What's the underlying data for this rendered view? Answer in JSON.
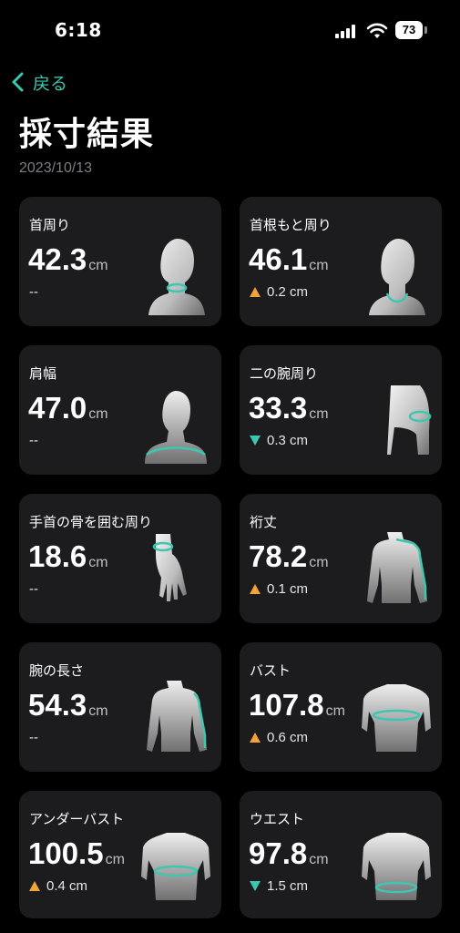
{
  "status": {
    "time": "6:18",
    "battery": "73"
  },
  "nav": {
    "back_label": "戻る"
  },
  "header": {
    "title": "採寸結果",
    "date": "2023/10/13"
  },
  "colors": {
    "accent": "#3cc7b0",
    "increase": "#f0a43a",
    "decrease": "#3cc7b0",
    "card": "#1c1c1e"
  },
  "cards": [
    {
      "label": "首周り",
      "value": "42.3",
      "unit": "cm",
      "change": "--",
      "trend": "none",
      "figure": "neck-figure-icon"
    },
    {
      "label": "首根もと周り",
      "value": "46.1",
      "unit": "cm",
      "change": "0.2 cm",
      "trend": "up",
      "figure": "neck-base-figure-icon"
    },
    {
      "label": "肩幅",
      "value": "47.0",
      "unit": "cm",
      "change": "--",
      "trend": "none",
      "figure": "shoulder-figure-icon"
    },
    {
      "label": "二の腕周り",
      "value": "33.3",
      "unit": "cm",
      "change": "0.3 cm",
      "trend": "down",
      "figure": "upper-arm-figure-icon"
    },
    {
      "label": "手首の骨を囲む周り",
      "value": "18.6",
      "unit": "cm",
      "change": "--",
      "trend": "none",
      "figure": "wrist-figure-icon"
    },
    {
      "label": "裄丈",
      "value": "78.2",
      "unit": "cm",
      "change": "0.1 cm",
      "trend": "up",
      "figure": "sleeve-length-figure-icon"
    },
    {
      "label": "腕の長さ",
      "value": "54.3",
      "unit": "cm",
      "change": "--",
      "trend": "none",
      "figure": "arm-length-figure-icon"
    },
    {
      "label": "バスト",
      "value": "107.8",
      "unit": "cm",
      "change": "0.6 cm",
      "trend": "up",
      "figure": "bust-figure-icon"
    },
    {
      "label": "アンダーバスト",
      "value": "100.5",
      "unit": "cm",
      "change": "0.4 cm",
      "trend": "up",
      "figure": "underbust-figure-icon"
    },
    {
      "label": "ウエスト",
      "value": "97.8",
      "unit": "cm",
      "change": "1.5 cm",
      "trend": "down",
      "figure": "waist-figure-icon"
    }
  ]
}
